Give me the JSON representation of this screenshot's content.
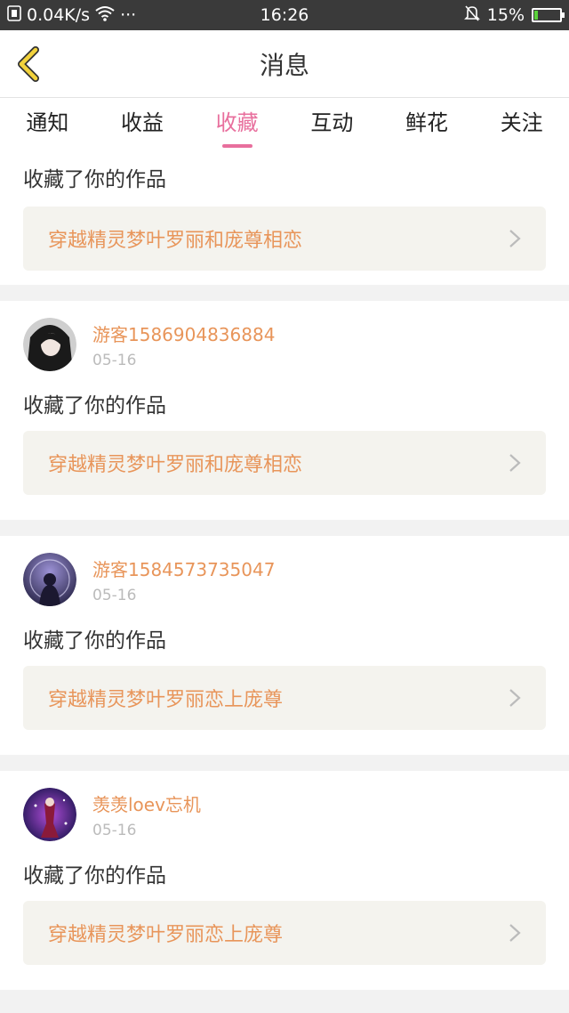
{
  "status_bar": {
    "speed": "0.04K/s",
    "dots": "···",
    "time": "16:26",
    "battery": "15%",
    "battery_level": 0.15
  },
  "header": {
    "title": "消息",
    "back_icon": "chevron-left-icon"
  },
  "tabs": [
    {
      "label": "通知",
      "active": false
    },
    {
      "label": "收益",
      "active": false
    },
    {
      "label": "收藏",
      "active": true
    },
    {
      "label": "互动",
      "active": false
    },
    {
      "label": "鲜花",
      "active": false
    },
    {
      "label": "关注",
      "active": false
    }
  ],
  "messages": [
    {
      "action": "收藏了你的作品",
      "work": "穿越精灵梦叶罗丽和庞尊相恋"
    },
    {
      "user": "游客1586904836884",
      "date": "05-16",
      "action": "收藏了你的作品",
      "work": "穿越精灵梦叶罗丽和庞尊相恋"
    },
    {
      "user": "游客1584573735047",
      "date": "05-16",
      "action": "收藏了你的作品",
      "work": "穿越精灵梦叶罗丽恋上庞尊"
    },
    {
      "user": "羡羡loev忘机",
      "date": "05-16",
      "action": "收藏了你的作品",
      "work": "穿越精灵梦叶罗丽恋上庞尊"
    }
  ],
  "colors": {
    "accent": "#e86f9d",
    "link": "#e8955a",
    "back_arrow": "#f2d23c"
  }
}
